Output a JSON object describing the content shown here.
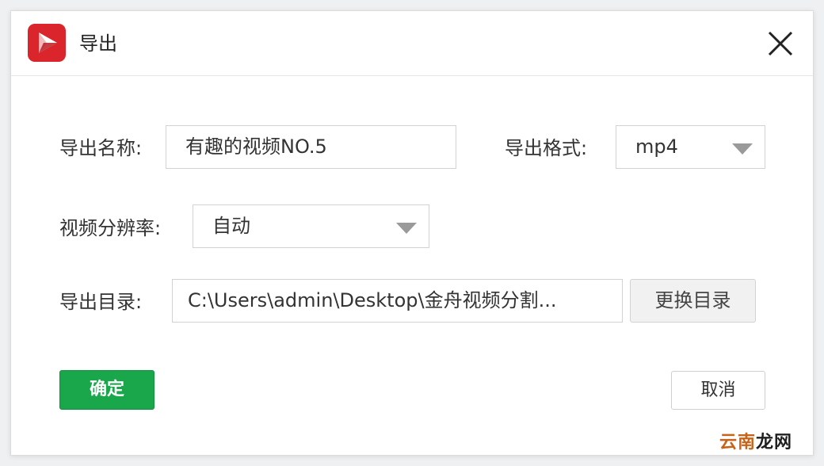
{
  "dialog": {
    "title": "导出",
    "logo_icon": "video-play-logo-icon",
    "close_icon": "close-x-icon"
  },
  "form": {
    "name_label": "导出名称:",
    "name_value": "有趣的视频NO.5",
    "format_label": "导出格式:",
    "format_value": "mp4",
    "resolution_label": "视频分辨率:",
    "resolution_value": "自动",
    "dir_label": "导出目录:",
    "dir_value": "C:\\Users\\admin\\Desktop\\金舟视频分割...",
    "change_dir_label": "更换目录"
  },
  "buttons": {
    "ok_label": "确定",
    "cancel_label": "取消"
  },
  "watermark": {
    "part1": "云南",
    "part2": "龙网"
  },
  "colors": {
    "primary_green": "#1aa64a",
    "logo_red": "#d9252b",
    "border": "#d2d2d2"
  }
}
